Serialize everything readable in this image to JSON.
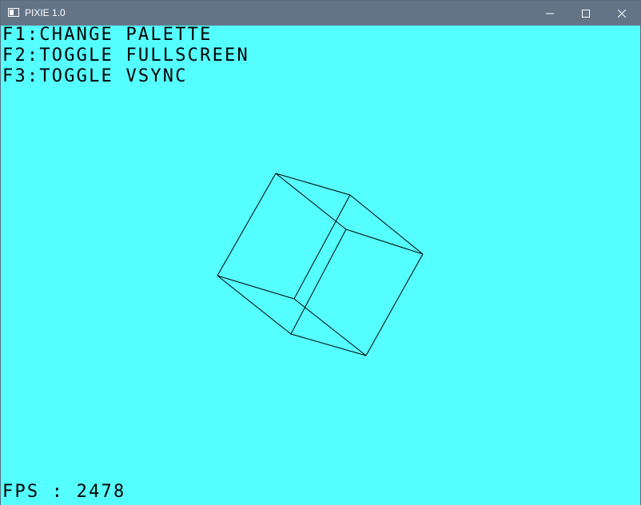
{
  "window": {
    "title": "PIXIE 1.0",
    "icon": "app-window-icon",
    "controls": [
      "minimize-icon",
      "maximize-icon",
      "close-icon"
    ]
  },
  "overlay": {
    "help_lines": [
      "F1:CHANGE PALETTE",
      "F2:TOGGLE FULLSCREEN",
      "F3:TOGGLE VSYNC"
    ],
    "fps_label": "FPS : 2478"
  },
  "colors": {
    "background": "#55ffff",
    "foreground": "#000000",
    "titlebar": "#647487"
  }
}
